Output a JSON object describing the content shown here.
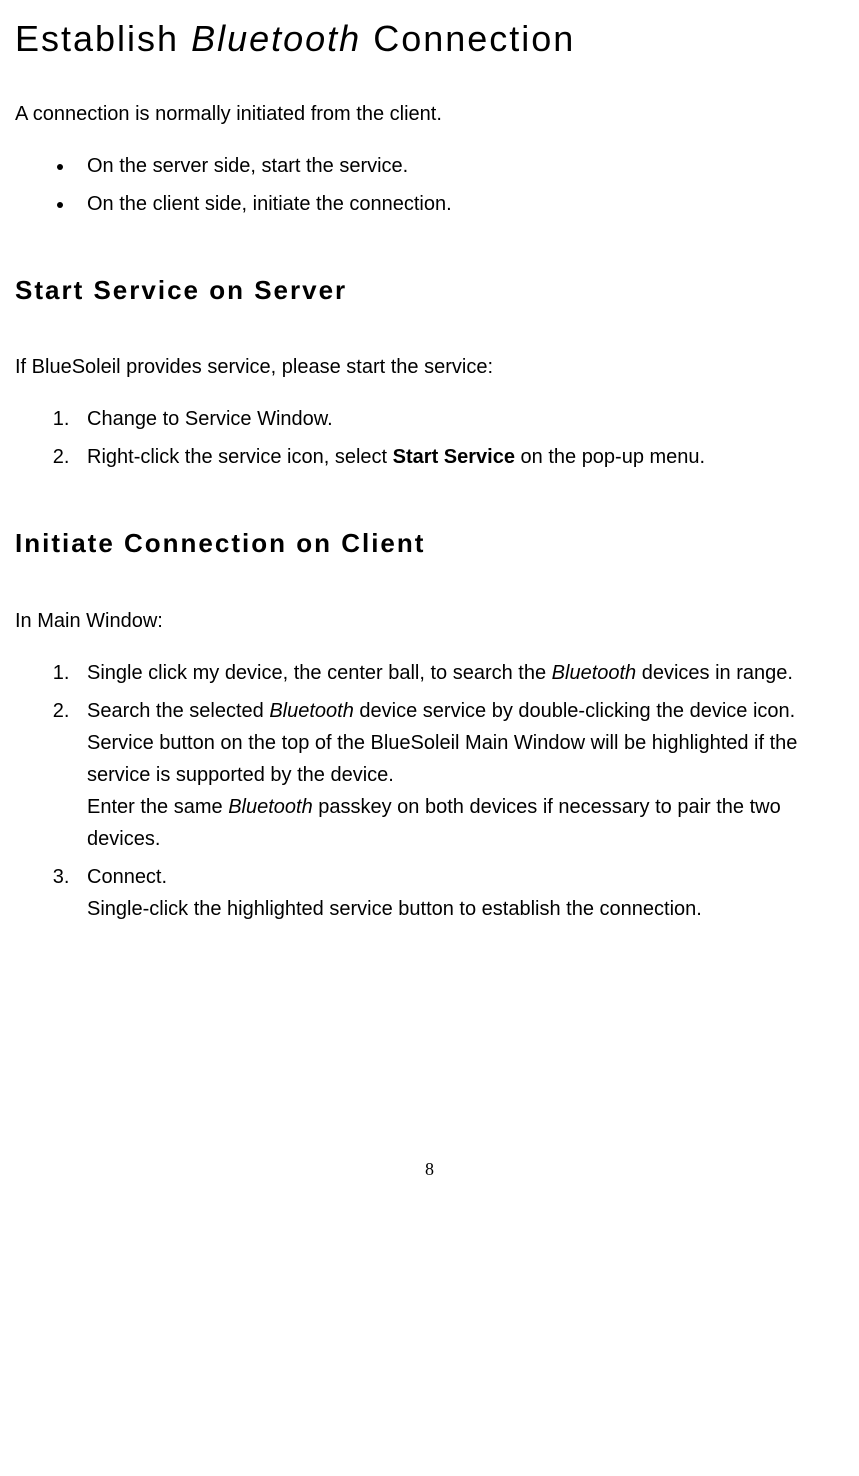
{
  "title": {
    "part1": "Establish ",
    "part2": "Bluetooth",
    "part3": " Connection"
  },
  "intro": "A connection is normally initiated from the client.",
  "intro_bullets": [
    "On the server side, start the service.",
    "On the client side, initiate the connection."
  ],
  "section1": {
    "heading": "Start Service on Server",
    "intro": "If BlueSoleil provides service, please start the service:",
    "steps": [
      {
        "text": "Change to Service Window."
      },
      {
        "prefix": "Right-click the service icon, select ",
        "bold": "Start Service",
        "suffix": " on the pop-up menu."
      }
    ]
  },
  "section2": {
    "heading": "Initiate Connection on Client",
    "intro": "In Main Window:",
    "steps": [
      {
        "prefix": "Single click my device, the center ball, to search the ",
        "italic": "Bluetooth",
        "suffix": " devices in range."
      },
      {
        "line1_prefix": "Search the selected ",
        "line1_italic": "Bluetooth",
        "line1_suffix": " device service by double-clicking the device icon.",
        "line2": "Service button on the top of the BlueSoleil Main Window will be highlighted if the service is supported by the device.",
        "line3_prefix": "Enter the same ",
        "line3_italic": "Bluetooth",
        "line3_suffix": " passkey on both devices if necessary to pair the two devices."
      },
      {
        "line1": "Connect.",
        "line2": "Single-click the highlighted service button to establish the connection."
      }
    ]
  },
  "page_number": "8"
}
